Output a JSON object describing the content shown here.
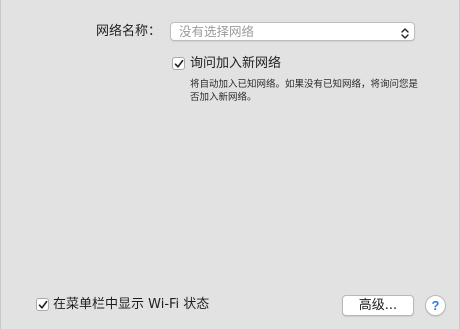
{
  "network_name": {
    "label": "网络名称：",
    "placeholder": "没有选择网络",
    "arrows_icon": "up-down-chevron-icon"
  },
  "ask_to_join": {
    "label": "询问加入新网络",
    "checked": true,
    "description": "将自动加入已知网络。如果没有已知网络，将询问您是否加入新网络。"
  },
  "show_in_menubar": {
    "label": "在菜单栏中显示 Wi-Fi 状态",
    "checked": true
  },
  "advanced_button": {
    "label": "高级..."
  },
  "help_button": {
    "label": "?",
    "icon": "help-icon",
    "color": "#2f7be8"
  }
}
